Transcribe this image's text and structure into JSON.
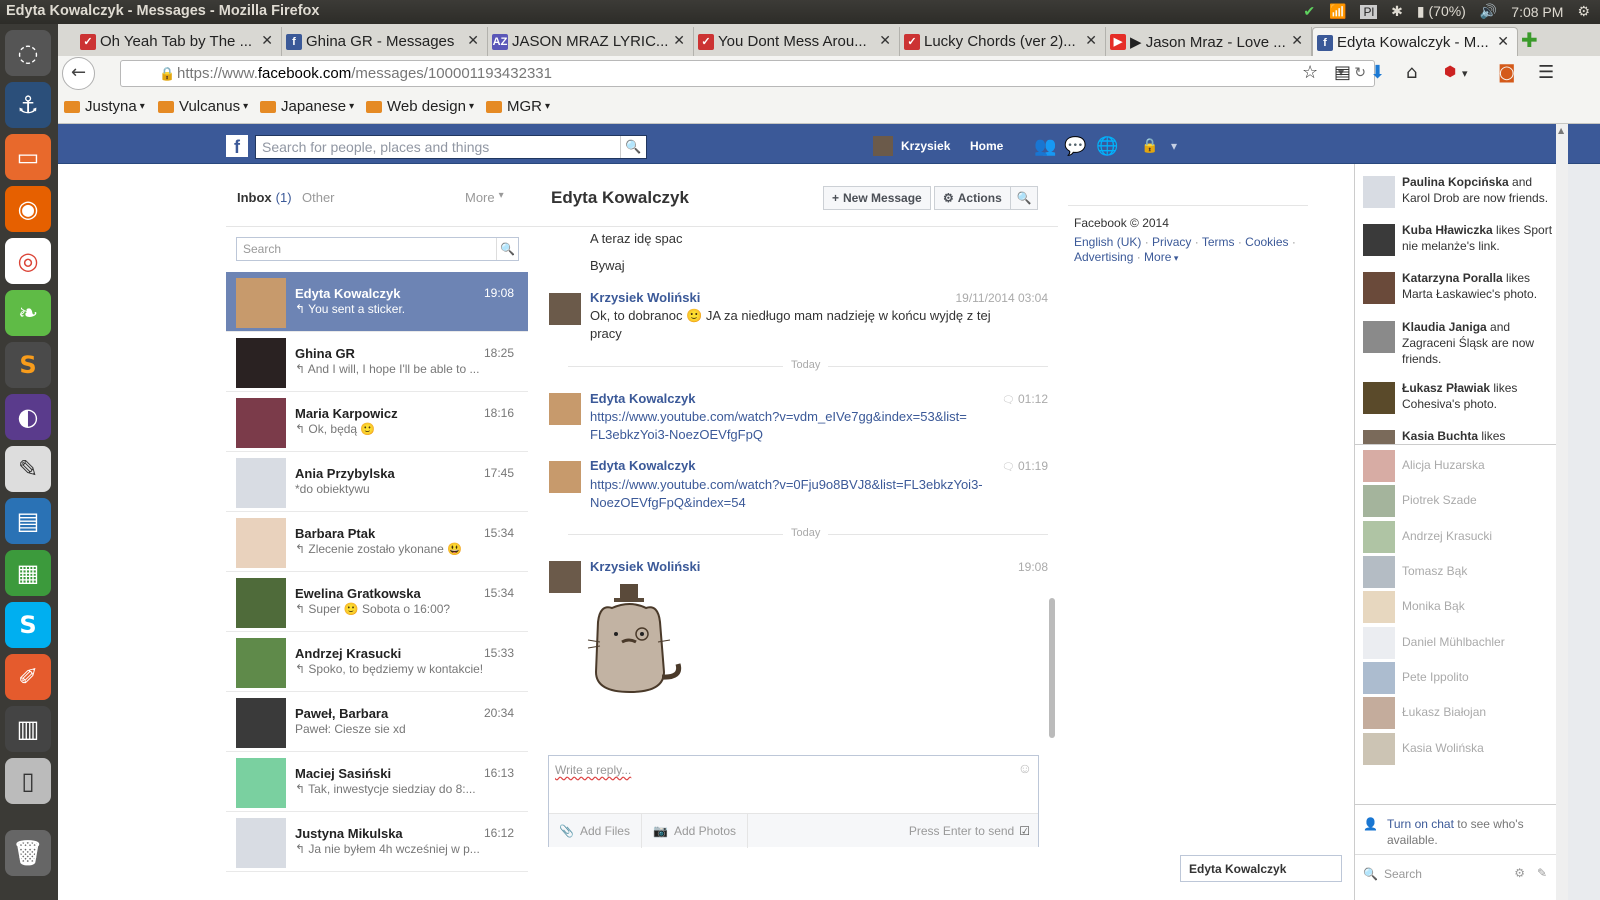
{
  "os": {
    "window_title": "Edyta Kowalczyk - Messages - Mozilla Firefox",
    "keyboard": "Pl",
    "battery": "(70%)",
    "clock": "7:08 PM"
  },
  "tabs": [
    {
      "label": "Oh Yeah Tab by The ...",
      "icon": "guitar-tab-icon"
    },
    {
      "label": "Ghina GR - Messages",
      "icon": "facebook-icon"
    },
    {
      "label": "JASON MRAZ LYRIC...",
      "icon": "az-lyrics-icon"
    },
    {
      "label": "You Dont Mess Arou...",
      "icon": "guitar-tab-icon"
    },
    {
      "label": "Lucky Chords (ver 2)...",
      "icon": "guitar-tab-icon"
    },
    {
      "label": "▶ Jason Mraz - Love ...",
      "icon": "youtube-icon"
    },
    {
      "label": "Edyta Kowalczyk - M...",
      "icon": "facebook-icon"
    }
  ],
  "url": {
    "prefix": "https://www.",
    "domain": "facebook.com",
    "path": "/messages/100001193432331"
  },
  "bookmarks": [
    "Justyna",
    "Vulcanus",
    "Japanese",
    "Web design",
    "MGR"
  ],
  "fb": {
    "search_placeholder": "Search for people, places and things",
    "user_name": "Krzysiek",
    "home_label": "Home"
  },
  "inbox": {
    "inbox_label": "Inbox",
    "inbox_count": "(1)",
    "other_label": "Other",
    "more_label": "More",
    "search_placeholder": "Search",
    "threads": [
      {
        "name": "Edyta Kowalczyk",
        "time": "19:08",
        "snippet": "↰ You sent a sticker.",
        "selected": true,
        "avatar_color": "#c79a6c"
      },
      {
        "name": "Ghina GR",
        "time": "18:25",
        "snippet": "↰ And I will, I hope I'll be able to ...",
        "avatar_color": "#2a2222"
      },
      {
        "name": "Maria Karpowicz",
        "time": "18:16",
        "snippet": "↰ Ok, będą 🙂",
        "avatar_color": "#7b3b4a"
      },
      {
        "name": "Ania Przybylska",
        "time": "17:45",
        "snippet": "*do obiektywu",
        "avatar_color": "#d8dce3"
      },
      {
        "name": "Barbara Ptak",
        "time": "15:34",
        "snippet": "↰ Zlecenie zostało ykonane 😃",
        "avatar_color": "#e9d2bd"
      },
      {
        "name": "Ewelina Gratkowska",
        "time": "15:34",
        "snippet": "↰ Super 🙂 Sobota o 16:00?",
        "avatar_color": "#4f6b3a"
      },
      {
        "name": "Andrzej Krasucki",
        "time": "15:33",
        "snippet": "↰ Spoko, to będziemy w kontakcie!",
        "avatar_color": "#5f8a4a"
      },
      {
        "name": "Paweł, Barbara",
        "time": "20:34",
        "snippet": "Paweł: Ciesze sie xd",
        "avatar_color": "#3a3a3a"
      },
      {
        "name": "Maciej Sasiński",
        "time": "16:13",
        "snippet": "↰ Tak, inwestycje siedziay do 8:...",
        "avatar_color": "#7ad0a0"
      },
      {
        "name": "Justyna Mikulska",
        "time": "16:12",
        "snippet": "↰ Ja nie byłem 4h wcześniej w p...",
        "avatar_color": "#d8dce3"
      }
    ]
  },
  "conversation": {
    "title": "Edyta Kowalczyk",
    "new_message_label": "New Message",
    "actions_label": "Actions",
    "lines_top": [
      "A teraz idę spac",
      "Bywaj"
    ],
    "msg1": {
      "name": "Krzysiek Woliński",
      "time": "19/11/2014 03:04",
      "text": "Ok, to dobranoc 🙂 JA za niedługo mam nadzieję w końcu wyjdę z tej pracy"
    },
    "divider1": "Today",
    "msg2": {
      "name": "Edyta Kowalczyk",
      "time": "01:12",
      "text": "https://www.youtube.com/watch?v=vdm_eIVe7gg&index=53&list=FL3ebkzYoi3-NoezOEVfgFpQ"
    },
    "msg3": {
      "name": "Edyta Kowalczyk",
      "time": "01:19",
      "text": "https://www.youtube.com/watch?v=0Fju9o8BVJ8&list=FL3ebkzYoi3-NoezOEVfgFpQ&index=54"
    },
    "divider2": "Today",
    "msg4": {
      "name": "Krzysiek Woliński",
      "time": "19:08"
    },
    "reply_placeholder": "Write a reply...",
    "add_files": "Add Files",
    "add_photos": "Add Photos",
    "press_enter": "Press Enter to send"
  },
  "right_info": {
    "copyright": "Facebook © 2014",
    "links": [
      "English (UK)",
      "Privacy",
      "Terms",
      "Cookies",
      "Advertising",
      "More"
    ]
  },
  "ticker": [
    {
      "name": "Paulina Kopcińska",
      "rest": " and Karol Drob are now friends.",
      "avatar_color": "#d8dce3"
    },
    {
      "name": "Kuba Hławiczka",
      "rest": " likes Sport nie melanże's link.",
      "avatar_color": "#3a3a3a"
    },
    {
      "name": "Katarzyna Poralla",
      "rest": " likes Marta Łaskawiec's photo.",
      "avatar_color": "#6a4a3a"
    },
    {
      "name": "Klaudia Janiga",
      "rest": " and Zagraceni Śląsk are now friends.",
      "avatar_color": "#8a8a8a"
    },
    {
      "name": "Łukasz Pławiak",
      "rest": " likes Cohesiva's photo.",
      "avatar_color": "#5a4a2a"
    },
    {
      "name": "Kasia Buchta",
      "rest": " likes",
      "avatar_color": "#7a6a5a"
    }
  ],
  "chat_friends": [
    {
      "name": "Alicja Huzarska",
      "avatar_color": "#b05a4a"
    },
    {
      "name": "Piotrek Szade",
      "avatar_color": "#4a6a3a"
    },
    {
      "name": "Andrzej Krasucki",
      "avatar_color": "#5f8a4a"
    },
    {
      "name": "Tomasz Bąk",
      "avatar_color": "#6a7a8a"
    },
    {
      "name": "Monika Bąk",
      "avatar_color": "#d0b080"
    },
    {
      "name": "Daniel Mühlbachler",
      "avatar_color": "#d8dce3"
    },
    {
      "name": "Pete Ippolito",
      "avatar_color": "#5a7aa0"
    },
    {
      "name": "Łukasz Białojan",
      "avatar_color": "#8a5a3a"
    },
    {
      "name": "Kasia Wolińska",
      "avatar_color": "#9a8a6a"
    }
  ],
  "chat_footer": {
    "turn_on": "Turn on chat",
    "rest": " to see who's available.",
    "search": "Search"
  },
  "chat_tab": "Edyta Kowalczyk"
}
